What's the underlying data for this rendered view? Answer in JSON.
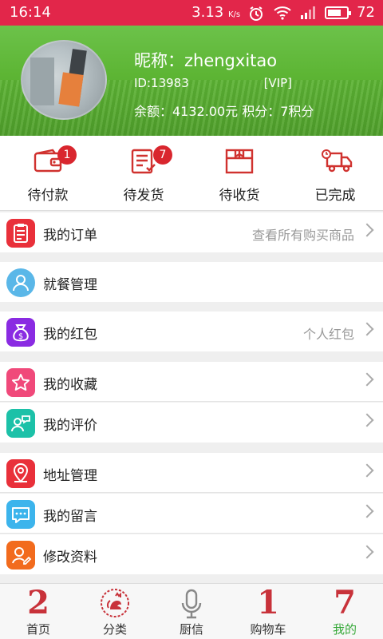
{
  "status": {
    "time": "16:14",
    "speed": "3.13",
    "speed_unit": "K/s",
    "battery": "72",
    "battery_level": 0.72
  },
  "profile": {
    "nickname": "昵称：zhengxitao",
    "id": "ID:13983",
    "vip": "[VIP]",
    "balance": "余额：4132.00元   积分：7积分"
  },
  "orders": [
    {
      "label": "待付款",
      "badge": "1",
      "icon": "wallet-icon"
    },
    {
      "label": "待发货",
      "badge": "7",
      "icon": "list-check-icon"
    },
    {
      "label": "待收货",
      "icon": "box-icon"
    },
    {
      "label": "已完成",
      "icon": "truck-icon"
    }
  ],
  "menu": [
    {
      "label": "我的订单",
      "hint": "查看所有购买商品",
      "icon": "clipboard-icon",
      "color": "#e9303a"
    },
    {
      "label": "就餐管理",
      "icon": "user-icon",
      "color": "#5ab7e8"
    },
    {
      "label": "我的红包",
      "hint": "个人红包",
      "icon": "money-bag-icon",
      "color": "#8a2be2"
    },
    {
      "label": "我的收藏",
      "icon": "star-icon",
      "color": "#f0497a"
    },
    {
      "label": "我的评价",
      "icon": "comment-user-icon",
      "color": "#1cc1a8"
    },
    {
      "label": "地址管理",
      "icon": "location-icon",
      "color": "#e9303a"
    },
    {
      "label": "我的留言",
      "icon": "message-icon",
      "color": "#3cb4ec"
    },
    {
      "label": "修改资料",
      "icon": "edit-user-icon",
      "color": "#f26b1d"
    }
  ],
  "tabs": [
    {
      "label": "首页",
      "glyph": "2",
      "icon": "home-icon"
    },
    {
      "label": "分类",
      "icon": "rooster-icon"
    },
    {
      "label": "厨信",
      "icon": "microphone-icon"
    },
    {
      "label": "购物车",
      "glyph": "1",
      "icon": "cart-icon"
    },
    {
      "label": "我的",
      "glyph": "7",
      "icon": "profile-icon"
    }
  ]
}
